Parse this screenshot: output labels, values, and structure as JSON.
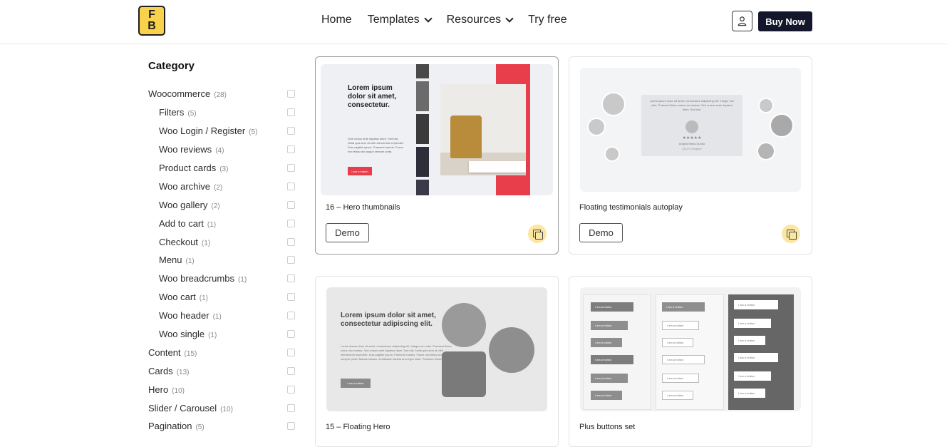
{
  "header": {
    "logo_letters": [
      "F",
      "B"
    ],
    "nav": [
      {
        "label": "Home",
        "has_dropdown": false
      },
      {
        "label": "Templates",
        "has_dropdown": true
      },
      {
        "label": "Resources",
        "has_dropdown": true
      },
      {
        "label": "Try free",
        "has_dropdown": false
      }
    ],
    "user_icon": "user-icon",
    "buy_label": "Buy Now"
  },
  "sidebar": {
    "title": "Category",
    "items": [
      {
        "label": "Woocommerce",
        "count": "(28)",
        "sub": false
      },
      {
        "label": "Filters",
        "count": "(5)",
        "sub": true
      },
      {
        "label": "Woo Login / Register",
        "count": "(5)",
        "sub": true
      },
      {
        "label": "Woo reviews",
        "count": "(4)",
        "sub": true
      },
      {
        "label": "Product cards",
        "count": "(3)",
        "sub": true
      },
      {
        "label": "Woo archive",
        "count": "(2)",
        "sub": true
      },
      {
        "label": "Woo gallery",
        "count": "(2)",
        "sub": true
      },
      {
        "label": "Add to cart",
        "count": "(1)",
        "sub": true
      },
      {
        "label": "Checkout",
        "count": "(1)",
        "sub": true
      },
      {
        "label": "Menu",
        "count": "(1)",
        "sub": true
      },
      {
        "label": "Woo breadcrumbs",
        "count": "(1)",
        "sub": true
      },
      {
        "label": "Woo cart",
        "count": "(1)",
        "sub": true
      },
      {
        "label": "Woo header",
        "count": "(1)",
        "sub": true
      },
      {
        "label": "Woo single",
        "count": "(1)",
        "sub": true
      },
      {
        "label": "Content",
        "count": "(15)",
        "sub": false
      },
      {
        "label": "Cards",
        "count": "(13)",
        "sub": false
      },
      {
        "label": "Hero",
        "count": "(10)",
        "sub": false
      },
      {
        "label": "Slider / Carousel",
        "count": "(10)",
        "sub": false
      },
      {
        "label": "Pagination",
        "count": "(5)",
        "sub": false
      }
    ]
  },
  "cards": [
    {
      "title": "16 – Hero thumbnails",
      "demo_label": "Demo",
      "copy_icon": "copy-icon",
      "preview": {
        "heading": "Lorem ipsum dolor sit amet, consectetur.",
        "body": "Sed cursus ante dapibus diam. Sed nisi. Nulla quis sem at nibh elementum imperdiet. Duis sagittis ipsum. Praesent mauris. Fusce nec tellus sed augue semper porta.",
        "button": "I am a button",
        "caption": "Lorem ipsum dolor sit amet, consectetur adipiscing elit. Fusce molestie.",
        "accent": "#e83e4c"
      }
    },
    {
      "title": "Floating testimonials autoplay",
      "demo_label": "Demo",
      "copy_icon": "copy-icon",
      "preview": {
        "quote": "Lorem ipsum dolor sit amet, consectetur adipiscing elit. Integer nec odio. Praesent libero uctus nec massa. Sed cursus ante dapibus diam. Sed nisi.",
        "name": "Angela Maria Dundo",
        "role": "UI/UX Designer",
        "stars": "★★★★★"
      }
    },
    {
      "title": "15 – Floating Hero",
      "demo_label": "Demo",
      "copy_icon": "copy-icon",
      "preview": {
        "heading": "Lorem ipsum dolor sit amet, consectetur adipiscing elit.",
        "body": "Lorem ipsum dolor sit amet, consectetur adipiscing elit. Integer nec odio. Praesent libero uctus nec massa. Sed cursus ante dapibus diam. Sed nisi. Nulla quis sem at nibh elementum imperdiet. Duis sagittis ipsum. Praesent mauris. Fusce nec tellus sed augue semper porta. Mauris massa. Vestibulum lacinia arcu eget nulla. Praesent himenaeos.",
        "button": "I am a button"
      }
    },
    {
      "title": "Plus buttons set",
      "demo_label": "Demo",
      "copy_icon": "copy-icon",
      "preview": {
        "button": "I am a button"
      }
    }
  ]
}
